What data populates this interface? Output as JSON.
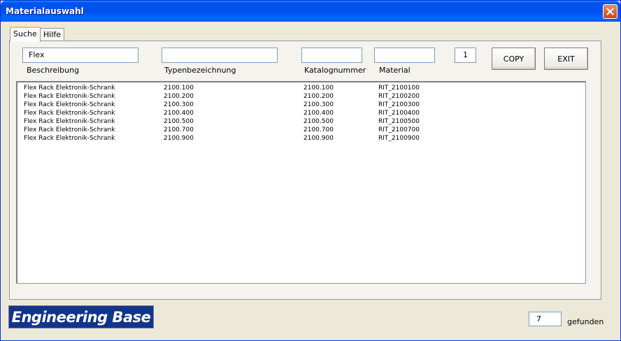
{
  "window": {
    "title": "Materialauswahl"
  },
  "tabs": [
    {
      "label": "Suche",
      "active": true
    },
    {
      "label": "Hilfe",
      "active": false
    }
  ],
  "search": {
    "beschreibung": {
      "label": "Beschreibung",
      "value": "Flex"
    },
    "typenbezeichnung": {
      "label": "Typenbezeichnung",
      "value": ""
    },
    "katalognummer": {
      "label": "Katalognummer",
      "value": ""
    },
    "material": {
      "label": "Material",
      "value": ""
    },
    "quantity": {
      "value": "1"
    }
  },
  "buttons": {
    "copy": "COPY",
    "exit": "EXIT"
  },
  "results": [
    [
      "Flex Rack Elektronik-Schrank",
      "2100.100",
      "2100.100",
      "RIT_2100100"
    ],
    [
      "Flex Rack Elektronik-Schrank",
      "2100.200",
      "2100.200",
      "RIT_2100200"
    ],
    [
      "Flex Rack Elektronik-Schrank",
      "2100.300",
      "2100.300",
      "RIT_2100300"
    ],
    [
      "Flex Rack Elektronik-Schrank",
      "2100.400",
      "2100.400",
      "RIT_2100400"
    ],
    [
      "Flex Rack Elektronik-Schrank",
      "2100.500",
      "2100.500",
      "RIT_2100500"
    ],
    [
      "Flex Rack Elektronik-Schrank",
      "2100.700",
      "2100.700",
      "RIT_2100700"
    ],
    [
      "Flex Rack Elektronik-Schrank",
      "2100.900",
      "2100.900",
      "RIT_2100900"
    ]
  ],
  "footer": {
    "logo": "Engineering Base",
    "count": "7",
    "count_label": "gefunden"
  },
  "colors": {
    "titlebar": "#0054e3",
    "logo_bg": "#12348a",
    "close": "#d2431a"
  },
  "icons": {
    "close": "close-icon"
  }
}
